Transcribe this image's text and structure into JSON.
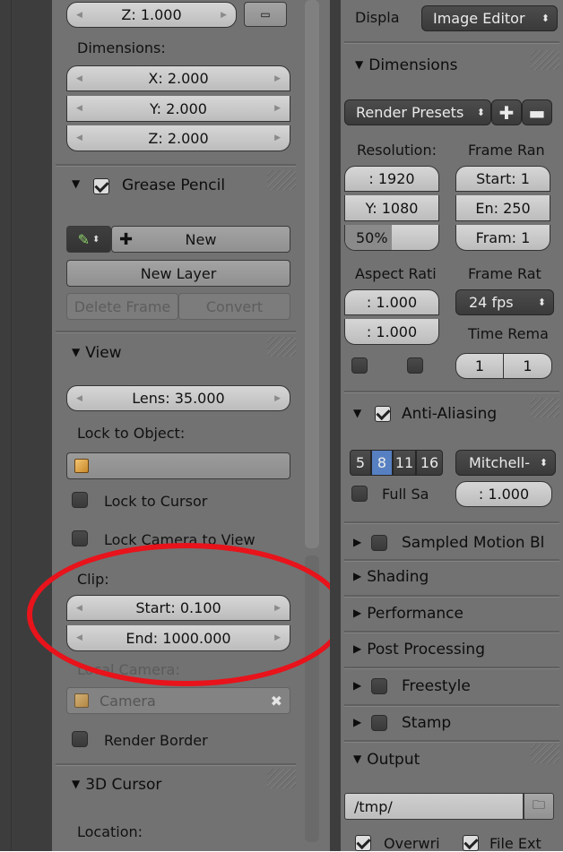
{
  "left": {
    "z_top": "Z: 1.000",
    "dimensions_label": "Dimensions:",
    "dim_x": "X: 2.000",
    "dim_y": "Y: 2.000",
    "dim_z": "Z: 2.000",
    "grease_pencil": {
      "title": "Grease Pencil",
      "new_label": "New",
      "new_layer_label": "New Layer",
      "delete_frame_label": "Delete Frame",
      "convert_label": "Convert"
    },
    "view": {
      "title": "View",
      "lens": "Lens: 35.000",
      "lock_to_object_label": "Lock to Object:",
      "lock_to_cursor": "Lock to Cursor",
      "lock_camera_to_view": "Lock Camera to View",
      "clip_label": "Clip:",
      "clip_start": "Start: 0.100",
      "clip_end": "End: 1000.000",
      "local_camera_label": "Local Camera:",
      "camera_value": "Camera",
      "render_border": "Render Border"
    },
    "cursor": {
      "title": "3D Cursor",
      "location_label": "Location:"
    }
  },
  "right": {
    "display_label": "Displa",
    "display_value": "Image Editor",
    "dimensions_title": "Dimensions",
    "render_presets": "Render Presets",
    "resolution_label": "Resolution:",
    "res_x": ": 1920",
    "res_y": "Y: 1080",
    "res_pct": "50%",
    "res_pct_fill": 0.5,
    "frame_range_label": "Frame Ran",
    "frame_start": "Start: 1",
    "frame_end": "En: 250",
    "frame_step": "Fram: 1",
    "aspect_label": "Aspect Rati",
    "aspect_x": ": 1.000",
    "aspect_y": ": 1.000",
    "frame_rate_label": "Frame Rat",
    "frame_rate_value": "24 fps",
    "time_remap_label": "Time Rema",
    "time_old": "1",
    "time_new": "1",
    "aa": {
      "title": "Anti-Aliasing",
      "samples": [
        "5",
        "8",
        "11",
        "16"
      ],
      "selected_sample": "8",
      "filter": "Mitchell-",
      "full_sample": "Full Sa",
      "filter_size": ": 1.000"
    },
    "sections": {
      "sampled_motion_blur": "Sampled Motion Bl",
      "shading": "Shading",
      "performance": "Performance",
      "post_processing": "Post Processing",
      "freestyle": "Freestyle",
      "stamp": "Stamp",
      "output": "Output"
    },
    "output_path": "/tmp/",
    "overwrite": "Overwri",
    "file_ext": "File Ext"
  },
  "colors": {
    "panel": "#727272",
    "dark": "#3d3d3d",
    "selected_blue": "#5680c2",
    "highlight": "#e8131b"
  }
}
